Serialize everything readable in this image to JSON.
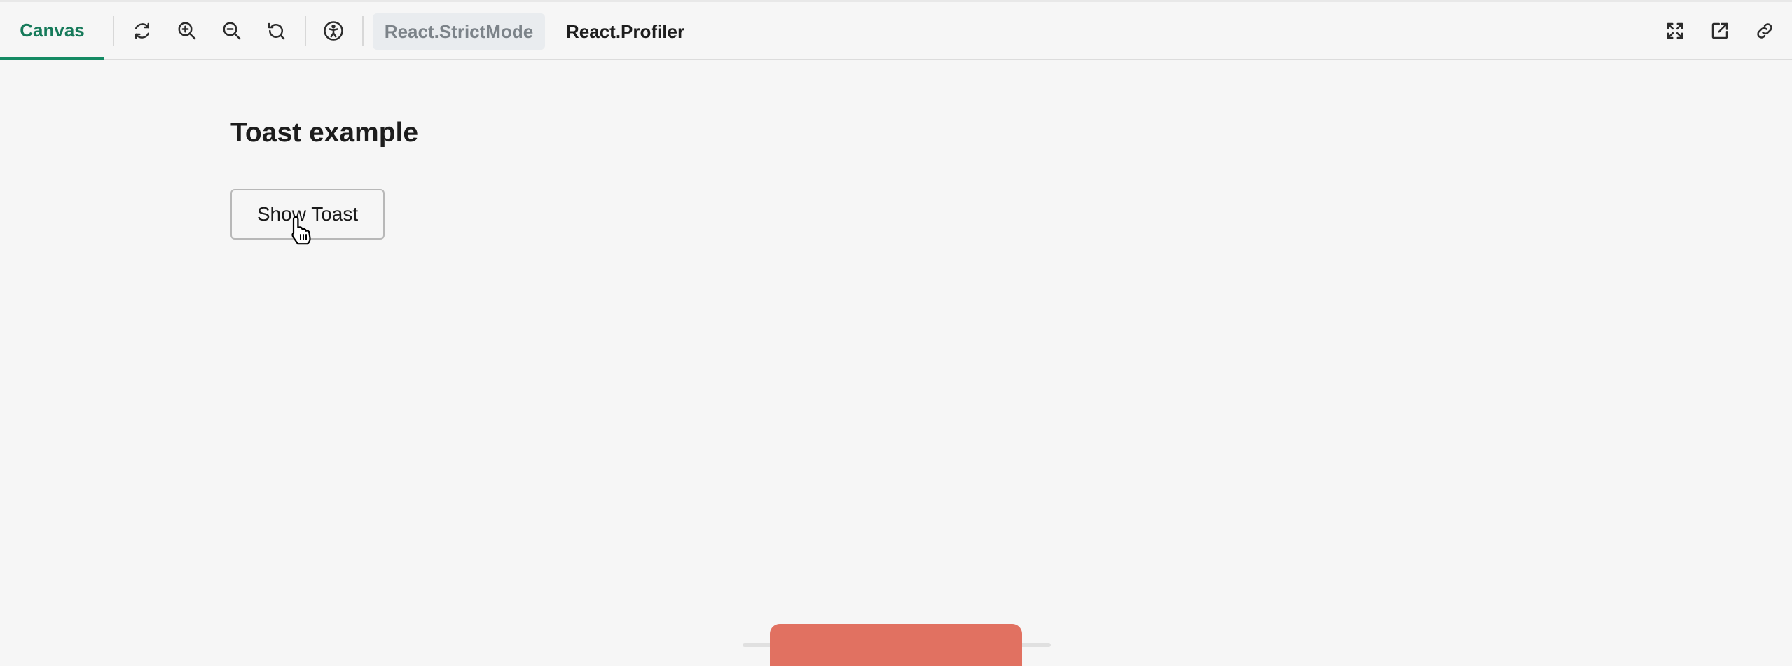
{
  "toolbar": {
    "canvas_tab": "Canvas",
    "strict_mode_label": "React.StrictMode",
    "profiler_label": "React.Profiler",
    "accent_color": "#148a63",
    "tools": [
      {
        "name": "reload-icon"
      },
      {
        "name": "zoom-in-icon"
      },
      {
        "name": "zoom-out-icon"
      },
      {
        "name": "reset-zoom-icon"
      },
      {
        "name": "accessibility-icon"
      }
    ],
    "right_tools": [
      {
        "name": "fullscreen-icon"
      },
      {
        "name": "open-new-tab-icon"
      },
      {
        "name": "copy-link-icon"
      }
    ]
  },
  "content": {
    "title": "Toast example",
    "show_toast_button": "Show Toast"
  },
  "toast": {
    "color": "#e17161"
  }
}
